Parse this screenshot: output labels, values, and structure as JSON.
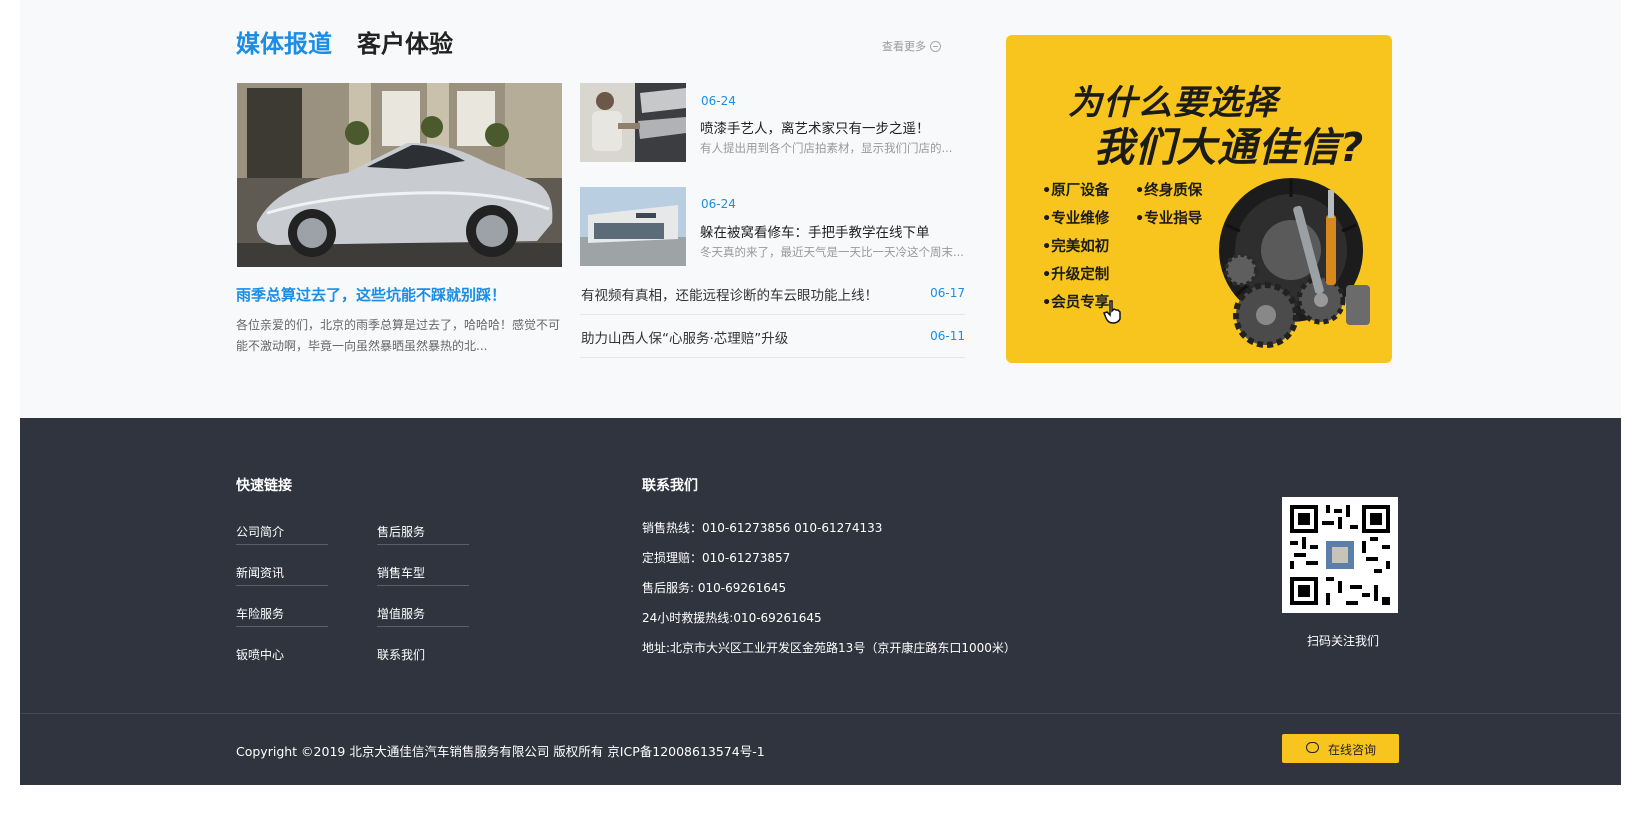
{
  "tabs": {
    "media": "媒体报道",
    "experience": "客户体验"
  },
  "more_link": "查看更多",
  "feature": {
    "title": "雨季总算过去了，这些坑能不踩就别踩！",
    "desc": "各位亲爱的们，北京的雨季总算是过去了，哈哈哈！感觉不可能不激动啊，毕竟一向虽然暴晒虽然暴热的北..."
  },
  "news_thumbs": [
    {
      "date": "06-24",
      "title": "喷漆手艺人，离艺术家只有一步之遥！",
      "excerpt": "有人提出用到各个门店拍素材，显示我们门店的..."
    },
    {
      "date": "06-24",
      "title": "躲在被窝看修车：手把手教学在线下单",
      "excerpt": "冬天真的来了，最近天气是一天比一天冷这个周末..."
    }
  ],
  "news_list": [
    {
      "title": "有视频有真相，还能远程诊断的车云眼功能上线！",
      "date": "06-17"
    },
    {
      "title": "助力山西人保“心服务·芯理赔”升级",
      "date": "06-11"
    }
  ],
  "promo": {
    "headline1": "为什么要选择",
    "headline2": "我们大通佳信?",
    "left_items": [
      "•原厂设备",
      "•专业维修",
      "•完美如初",
      "•升级定制",
      "•会员专享"
    ],
    "right_items": [
      "•终身质保",
      "•专业指导"
    ],
    "colors": {
      "background": "#f7c51d"
    },
    "images": [
      "tire-icon",
      "gears-icon",
      "wrench-icon",
      "cursor-hand-icon"
    ]
  },
  "footer": {
    "links_title": "快速链接",
    "links_col1": [
      "公司简介",
      "新闻资讯",
      "车险服务",
      "钣喷中心"
    ],
    "links_col2": [
      "售后服务",
      "销售车型",
      "增值服务",
      "联系我们"
    ],
    "contact_title": "联系我们",
    "contact": [
      "销售热线：010-61273856  010-61274133",
      "定损理赔：010-61273857",
      "售后服务: 010-69261645",
      "24小时救援热线:010-69261645",
      "地址:北京市大兴区工业开发区金苑路13号（京开康庄路东口1000米）"
    ],
    "qr_caption": "扫码关注我们",
    "copyright": "Copyright ©2019 北京大通佳信汽车销售服务有限公司 版权所有 京ICP备12008613574号-1",
    "consult_button": "在线咨询",
    "colors": {
      "footer_bg": "#30343f",
      "accent_blue": "#1a8ee6",
      "accent_yellow": "#f7c51d"
    }
  }
}
